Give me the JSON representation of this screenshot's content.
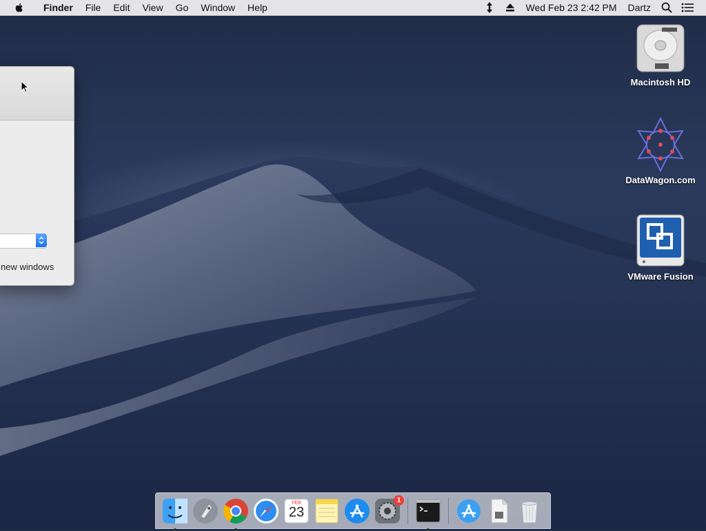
{
  "menubar": {
    "app_name": "Finder",
    "menus": [
      "File",
      "Edit",
      "View",
      "Go",
      "Window",
      "Help"
    ],
    "datetime": "Wed Feb 23  2:42 PM",
    "user": "Dartz",
    "icons": [
      "apple-icon",
      "network-arrows-icon",
      "eject-icon",
      "spotlight-search-icon",
      "notification-center-icon"
    ]
  },
  "window": {
    "caption": "new windows"
  },
  "desktop_icons": [
    {
      "label": "Macintosh HD",
      "icon": "hard-drive-icon"
    },
    {
      "label": "DataWagon.com",
      "icon": "datawagon-icon"
    },
    {
      "label": "VMware Fusion",
      "icon": "vmware-fusion-icon"
    }
  ],
  "dock": {
    "items": [
      {
        "name": "finder",
        "icon": "finder-icon",
        "running": true
      },
      {
        "name": "launchpad",
        "icon": "launchpad-icon",
        "running": false
      },
      {
        "name": "chrome",
        "icon": "chrome-icon",
        "running": true
      },
      {
        "name": "safari",
        "icon": "safari-icon",
        "running": false
      },
      {
        "name": "calendar",
        "icon": "calendar-icon",
        "running": false,
        "month": "FEB",
        "day": "23"
      },
      {
        "name": "notes",
        "icon": "notes-icon",
        "running": false
      },
      {
        "name": "app-store",
        "icon": "app-store-icon",
        "running": false
      },
      {
        "name": "system-preferences",
        "icon": "system-preferences-icon",
        "running": false,
        "badge": "1"
      },
      {
        "name": "terminal",
        "icon": "terminal-icon",
        "running": true
      },
      {
        "name": "app-store-downloads",
        "icon": "app-store-folder-icon",
        "running": false
      },
      {
        "name": "document",
        "icon": "document-icon",
        "running": false
      },
      {
        "name": "trash",
        "icon": "trash-icon",
        "running": false
      }
    ]
  },
  "colors": {
    "menubar_bg": "#ececec",
    "desktop_dark": "#1f2c47",
    "accent_blue": "#1b74ea",
    "badge_red": "#ef3e36"
  }
}
